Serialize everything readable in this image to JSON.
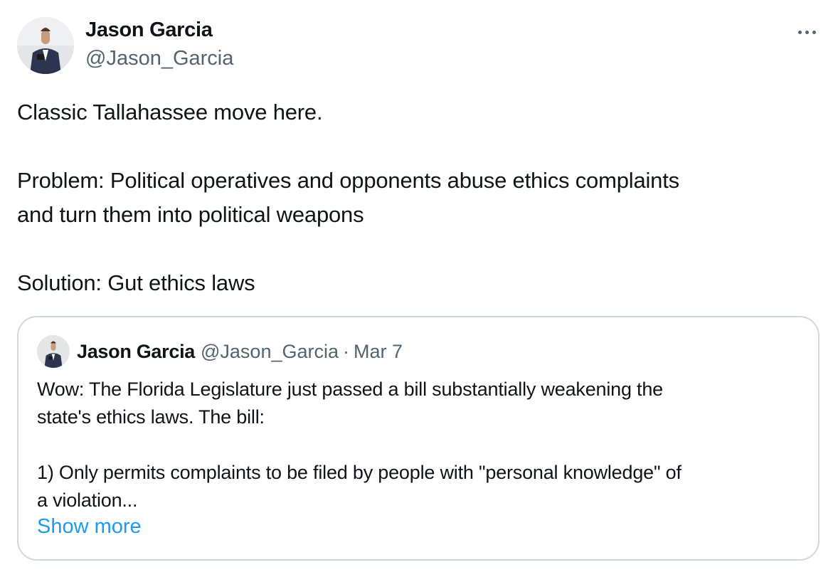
{
  "tweet": {
    "author": {
      "name": "Jason Garcia",
      "handle": "@Jason_Garcia",
      "avatar_icon": "profile-photo"
    },
    "more_icon": "more-horizontal-icon",
    "text": {
      "line1": "Classic Tallahassee move here.",
      "line2": "Problem: Political operatives and opponents abuse ethics complaints",
      "line3": "and turn them into political weapons",
      "line4": "Solution: Gut ethics laws"
    }
  },
  "quote": {
    "author": {
      "name": "Jason Garcia",
      "handle": "@Jason_Garcia",
      "separator": "·",
      "date": "Mar 7"
    },
    "text": {
      "line1": "Wow: The Florida Legislature just passed a bill substantially weakening the",
      "line2": "state's ethics laws. The bill:",
      "line3": "1) Only permits complaints to be filed by people with \"personal knowledge\" of",
      "line4": "a violation..."
    },
    "show_more": "Show more"
  },
  "colors": {
    "text": "#0f1419",
    "secondary": "#536471",
    "link": "#1d9bf0",
    "border": "#cfd9de"
  }
}
